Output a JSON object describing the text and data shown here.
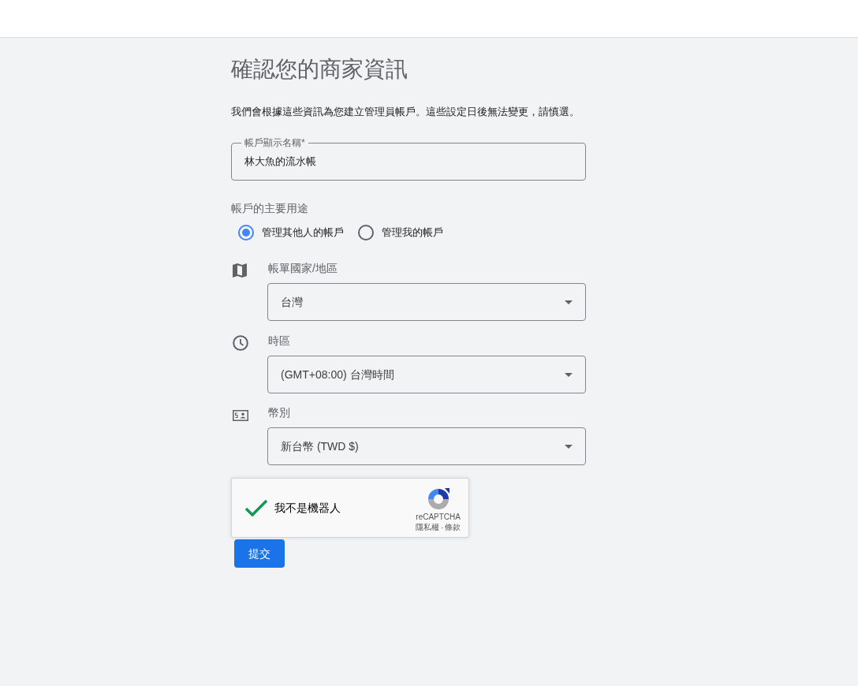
{
  "page": {
    "title": "確認您的商家資訊",
    "description": "我們會根據這些資訊為您建立管理員帳戶。這些設定日後無法變更，請慎選。"
  },
  "account_name_field": {
    "label": "帳戶顯示名稱*",
    "value": "林大魚的流水帳"
  },
  "usage": {
    "label": "帳戶的主要用途",
    "options": [
      {
        "label": "管理其他人的帳戶",
        "selected": true
      },
      {
        "label": "管理我的帳戶",
        "selected": false
      }
    ]
  },
  "settings": [
    {
      "kind": "map",
      "label": "帳單國家/地區",
      "value": "台灣"
    },
    {
      "kind": "clock",
      "label": "時區",
      "value": "(GMT+08:00) 台灣時間"
    },
    {
      "kind": "currency",
      "label": "幣別",
      "value": "新台幣 (TWD $)"
    }
  ],
  "recaptcha": {
    "checked": true,
    "label": "我不是機器人",
    "brand": "reCAPTCHA",
    "privacy_link": "隱私權",
    "separator": "-",
    "terms_link": "條款"
  },
  "submit_button": "提交"
}
